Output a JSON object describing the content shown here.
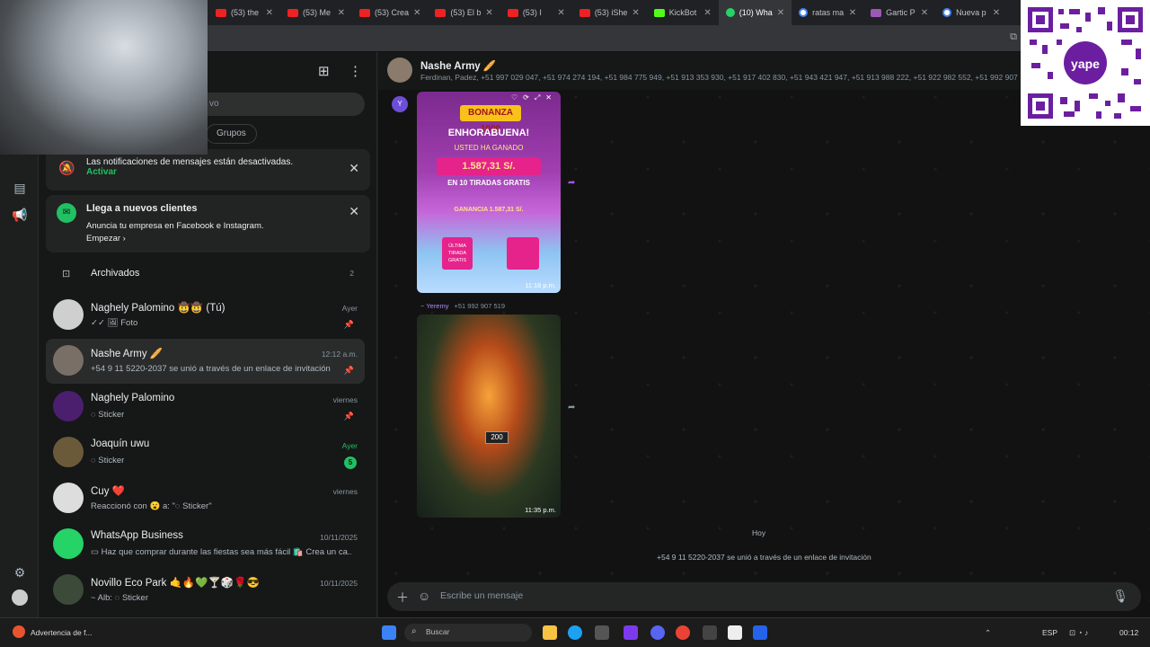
{
  "browser": {
    "tabs": [
      {
        "label": "(53) the",
        "fav": "yt"
      },
      {
        "label": "(53) Me",
        "fav": "yt"
      },
      {
        "label": "(53) Crea",
        "fav": "yt"
      },
      {
        "label": "(53) El b",
        "fav": "yt"
      },
      {
        "label": "(53) I",
        "fav": "yt"
      },
      {
        "label": "(53) iShe",
        "fav": "yt"
      },
      {
        "label": "KickBot",
        "fav": "kb"
      },
      {
        "label": "(10) Wha",
        "fav": "wa",
        "active": true
      },
      {
        "label": "ratas ma",
        "fav": "gg"
      },
      {
        "label": "Gartic P",
        "fav": "gp"
      },
      {
        "label": "Nueva p",
        "fav": "gg"
      }
    ],
    "close_glyph": "✕"
  },
  "sidebar": {
    "search_placeholder": "vo",
    "filters": [
      "Grupos"
    ],
    "notice_muted": {
      "text": "Las notificaciones de mensajes están desactivadas.",
      "action": "Activar"
    },
    "notice_ads": {
      "title": "Llega a nuevos clientes",
      "body": "Anuncia tu empresa en Facebook e Instagram.",
      "action": "Empezar"
    },
    "archived": {
      "label": "Archivados",
      "count": "2"
    },
    "chats": [
      {
        "name": "Naghely Palomino 🤠🤠 (Tú)",
        "last": "✓✓ 🖼 Foto",
        "time": "Ayer",
        "pinned": true,
        "avatar": "#cfcfcf"
      },
      {
        "name": "Nashe Army 🥖",
        "last": "+54 9 11 5220-2037 se unió a través de un enlace de invitación",
        "time": "12:12 a.m.",
        "pinned": true,
        "selected": true,
        "avatar": "#7a6f66"
      },
      {
        "name": "Naghely Palomino",
        "last": "◌ Sticker",
        "time": "viernes",
        "pinned": true,
        "avatar": "#4b1f6e"
      },
      {
        "name": "Joaquín uwu",
        "last": "◌ Sticker",
        "time": "Ayer",
        "unread": "5",
        "avatar": "#6b5a3a"
      },
      {
        "name": "Cuy ❤️",
        "last": "Reaccionó con 😮 a: \"◌ Sticker\"",
        "time": "viernes",
        "avatar": "#dddddd"
      },
      {
        "name": "WhatsApp Business",
        "last": "▭ Haz que comprar durante las fiestas sea más fácil 🛍️ Crea un ca...",
        "time": "10/11/2025",
        "avatar": "#25d366"
      },
      {
        "name": "Novillo Eco Park 🤙🔥💚🍸🎲🌹😎",
        "last": "~ Alb: ◌ Sticker",
        "time": "10/11/2025",
        "avatar": "#3c4a3a"
      }
    ]
  },
  "chat": {
    "title": "Nashe Army 🥖",
    "members": "Ferdinan, Padez, +51 997 029 047, +51 974 274 194, +51 984 775 949, +51 913 353 930, +51 917 402 830, +51 943 421 947, +51 913 988 222, +51 922 982 552, +51 992 907",
    "avatar_letter": "Y",
    "image1": {
      "game": "BONANZA 1000",
      "congrats": "ENHORABUENA!",
      "won": "USTED HA GANADO",
      "amount": "1.587,31 S/.",
      "spins": "EN 10 TIRADAS GRATIS",
      "gain": "GANANCIA 1.587,31 S/.",
      "last": "ÚLTIMA TIRADA GRATIS",
      "time": "11:18 p.m."
    },
    "sender": {
      "name": "~ Yeremy",
      "phone": "+51 992 907 519"
    },
    "image2": {
      "label": "200",
      "time": "11:35 p.m."
    },
    "day_divider": "Hoy",
    "system_msg": "+54 9 11 5220-2037 se unió a través de un enlace de invitación",
    "composer_placeholder": "Escribe un mensaje"
  },
  "taskbar": {
    "notification": "Advertencia de f...",
    "search": "Buscar",
    "lang": "ESP",
    "clock": "00:12"
  },
  "colors": {
    "accent": "#21c063",
    "bg": "#121212",
    "sidebar": "#161717"
  }
}
